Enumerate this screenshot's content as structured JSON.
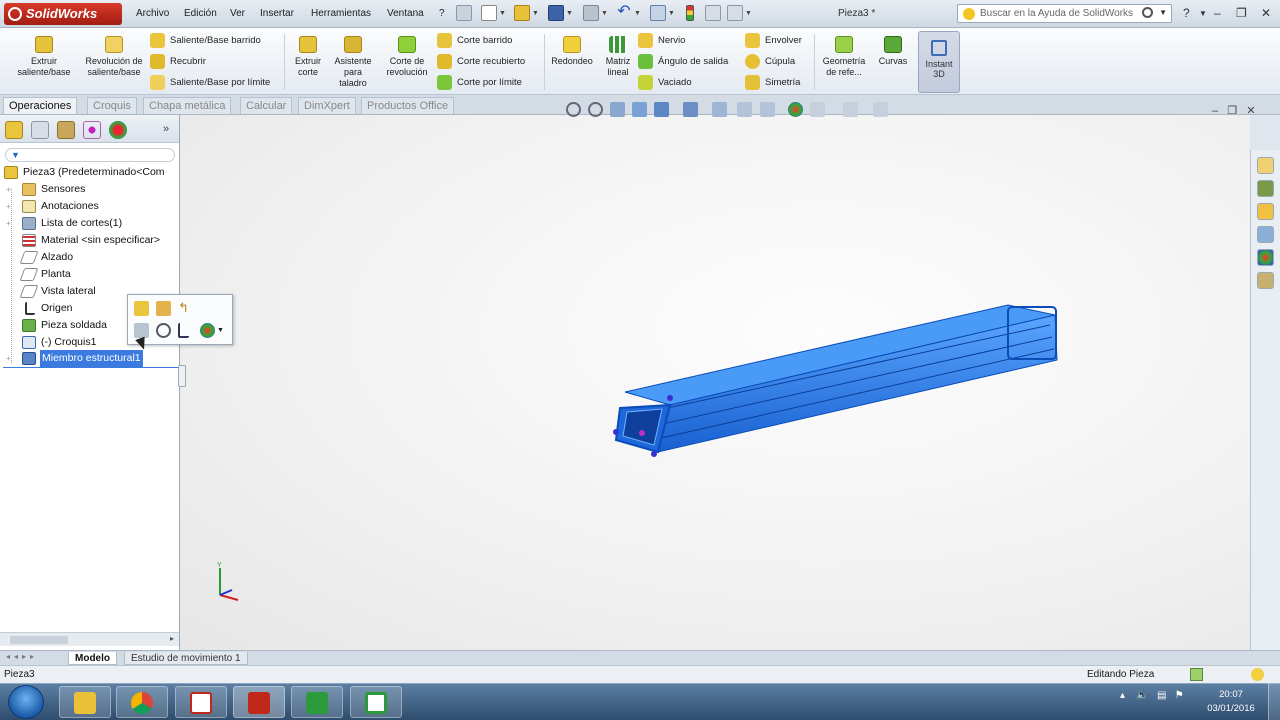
{
  "app": {
    "name": "SolidWorks",
    "document_title": "Pieza3 *",
    "menus": [
      "Archivo",
      "Edición",
      "Ver",
      "Insertar",
      "Herramientas",
      "Ventana",
      "?"
    ],
    "search_placeholder": "Buscar en la Ayuda de SolidWorks"
  },
  "ribbon": {
    "extruir_saliente": "Extruir saliente/base",
    "revolucion_saliente": "Revolución de saliente/base",
    "saliente_barrido": "Saliente/Base barrido",
    "recubrir": "Recubrir",
    "saliente_limite": "Saliente/Base por límite",
    "extruir_corte": "Extruir corte",
    "asistente_taladro": "Asistente para taladro",
    "corte_revolucion": "Corte de revolución",
    "corte_barrido": "Corte barrido",
    "corte_recubierto": "Corte recubierto",
    "corte_limite": "Corte por límite",
    "redondeo": "Redondeo",
    "matriz_lineal": "Matriz lineal",
    "nervio": "Nervio",
    "angulo_salida": "Ángulo de salida",
    "vaciado": "Vaciado",
    "envolver": "Envolver",
    "cupula": "Cúpula",
    "simetria": "Simetría",
    "geometria_ref": "Geometría de refe...",
    "curvas": "Curvas",
    "instant3d": "Instant 3D"
  },
  "command_tabs": [
    "Operaciones",
    "Croquis",
    "Chapa metálica",
    "Calcular",
    "DimXpert",
    "Productos Office"
  ],
  "feature_tree": {
    "root": "Pieza3  (Predeterminado<Com",
    "items": [
      {
        "label": "Sensores",
        "icon": "sensors-icon"
      },
      {
        "label": "Anotaciones",
        "icon": "annotations-icon"
      },
      {
        "label": "Lista de cortes(1)",
        "icon": "cut-list-icon"
      },
      {
        "label": "Material <sin especificar>",
        "icon": "material-icon"
      },
      {
        "label": "Alzado",
        "icon": "plane-icon"
      },
      {
        "label": "Planta",
        "icon": "plane-icon"
      },
      {
        "label": "Vista lateral",
        "icon": "plane-icon"
      },
      {
        "label": "Origen",
        "icon": "origin-icon"
      },
      {
        "label": "Pieza soldada",
        "icon": "weldment-icon"
      },
      {
        "label": "(-) Croquis1",
        "icon": "sketch-icon"
      },
      {
        "label": "Miembro estructural1",
        "icon": "structural-member-icon"
      }
    ]
  },
  "bottom_tabs": [
    "Modelo",
    "Estudio de movimiento 1"
  ],
  "status": {
    "left": "Pieza3",
    "right": "Editando Pieza"
  },
  "clock": {
    "time": "20:07",
    "date": "03/01/2016"
  },
  "colors": {
    "accent": "#3b7be0",
    "model_blue": "#1f7ce8",
    "solidworks_red": "#c0281a"
  }
}
